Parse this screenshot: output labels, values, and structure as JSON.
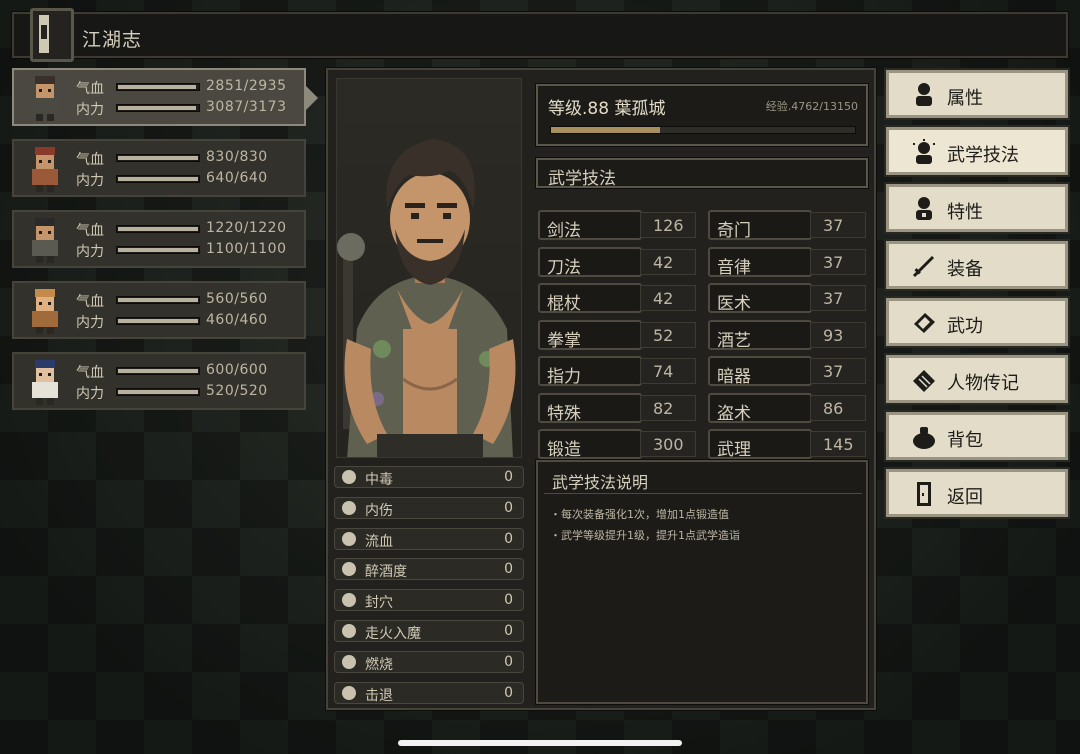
{
  "title": "江湖志",
  "party": [
    {
      "hp_label": "气血",
      "hp": "2851/2935",
      "hp_ratio": 0.97,
      "mp_label": "内力",
      "mp": "3087/3173",
      "mp_ratio": 0.97
    },
    {
      "hp_label": "气血",
      "hp": "830/830",
      "hp_ratio": 1.0,
      "mp_label": "内力",
      "mp": "640/640",
      "mp_ratio": 1.0
    },
    {
      "hp_label": "气血",
      "hp": "1220/1220",
      "hp_ratio": 1.0,
      "mp_label": "内力",
      "mp": "1100/1100",
      "mp_ratio": 1.0
    },
    {
      "hp_label": "气血",
      "hp": "560/560",
      "hp_ratio": 1.0,
      "mp_label": "内力",
      "mp": "460/460",
      "mp_ratio": 1.0
    },
    {
      "hp_label": "气血",
      "hp": "600/600",
      "hp_ratio": 1.0,
      "mp_label": "内力",
      "mp": "520/520",
      "mp_ratio": 1.0
    }
  ],
  "character": {
    "level_text": "等级.88 葉孤城",
    "exp_text": "经验.4762/13150",
    "exp_ratio": 0.36
  },
  "section_title": "武学技法",
  "skills": [
    {
      "name": "剑法",
      "value": "126"
    },
    {
      "name": "奇门",
      "value": "37"
    },
    {
      "name": "刀法",
      "value": "42"
    },
    {
      "name": "音律",
      "value": "37"
    },
    {
      "name": "棍杖",
      "value": "42"
    },
    {
      "name": "医术",
      "value": "37"
    },
    {
      "name": "拳掌",
      "value": "52"
    },
    {
      "name": "酒艺",
      "value": "93"
    },
    {
      "name": "指力",
      "value": "74"
    },
    {
      "name": "暗器",
      "value": "37"
    },
    {
      "name": "特殊",
      "value": "82"
    },
    {
      "name": "盗术",
      "value": "86"
    },
    {
      "name": "锻造",
      "value": "300"
    },
    {
      "name": "武理",
      "value": "145"
    }
  ],
  "status_effects": [
    {
      "icon": "skull-icon",
      "label": "中毒",
      "value": "0"
    },
    {
      "icon": "broken-heart-icon",
      "label": "内伤",
      "value": "0"
    },
    {
      "icon": "blood-drop-icon",
      "label": "流血",
      "value": "0"
    },
    {
      "icon": "drunk-face-icon",
      "label": "醉酒度",
      "value": "0"
    },
    {
      "icon": "acupoint-icon",
      "label": "封穴",
      "value": "0"
    },
    {
      "icon": "demon-face-icon",
      "label": "走火入魔",
      "value": "0"
    },
    {
      "icon": "flame-icon",
      "label": "燃烧",
      "value": "0"
    },
    {
      "icon": "knockback-icon",
      "label": "击退",
      "value": "0"
    }
  ],
  "description": {
    "title": "武学技法说明",
    "lines": [
      "・每次装备强化1次，增加1点锻造值",
      "・武学等级提升1级，提升1点武学造诣"
    ]
  },
  "menu": [
    {
      "icon": "person-icon",
      "label": "属性"
    },
    {
      "icon": "person-sparkle-icon",
      "label": "武学技法"
    },
    {
      "icon": "person-star-icon",
      "label": "特性"
    },
    {
      "icon": "sword-icon",
      "label": "装备"
    },
    {
      "icon": "book-icon",
      "label": "武功"
    },
    {
      "icon": "scroll-icon",
      "label": "人物传记"
    },
    {
      "icon": "bag-icon",
      "label": "背包"
    },
    {
      "icon": "door-icon",
      "label": "返回"
    }
  ],
  "colors": {
    "accent": "#a7905e",
    "panel": "#22211d",
    "button": "#e2dcc8"
  }
}
